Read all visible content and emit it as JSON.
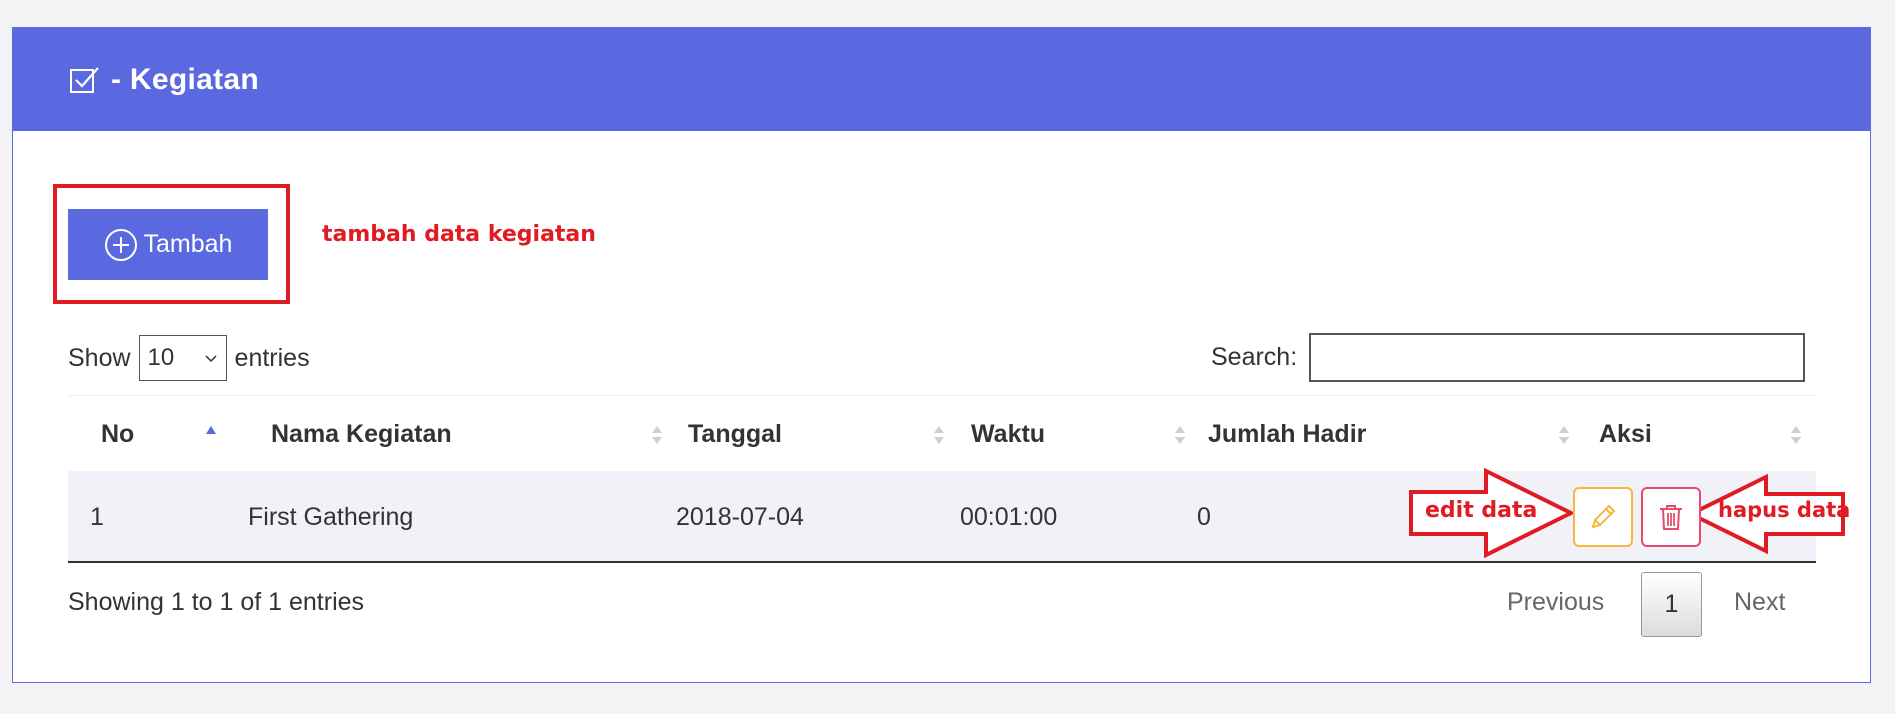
{
  "header": {
    "title": "- Kegiatan",
    "icon": "checkbox-icon"
  },
  "toolbar": {
    "add_label": "Tambah",
    "add_icon": "plus-circle-icon"
  },
  "annotations": {
    "add": "tambah data kegiatan",
    "edit": "edit data",
    "delete": "hapus data"
  },
  "length": {
    "show_label": "Show",
    "value": "10",
    "entries_label": "entries"
  },
  "search": {
    "label": "Search:",
    "value": ""
  },
  "table": {
    "columns": [
      "No",
      "Nama Kegiatan",
      "Tanggal",
      "Waktu",
      "Jumlah Hadir",
      "Aksi"
    ],
    "sorted_column": "No",
    "sort_direction": "asc",
    "rows": [
      [
        "1",
        "First Gathering",
        "2018-07-04",
        "00:01:00",
        "0"
      ]
    ]
  },
  "footer": {
    "info": "Showing 1 to 1 of 1 entries",
    "previous": "Previous",
    "page": "1",
    "next": "Next"
  },
  "colors": {
    "primary": "#5a69e0",
    "annotation": "#e01b24",
    "edit": "#f5b740",
    "delete": "#e64b6e"
  }
}
